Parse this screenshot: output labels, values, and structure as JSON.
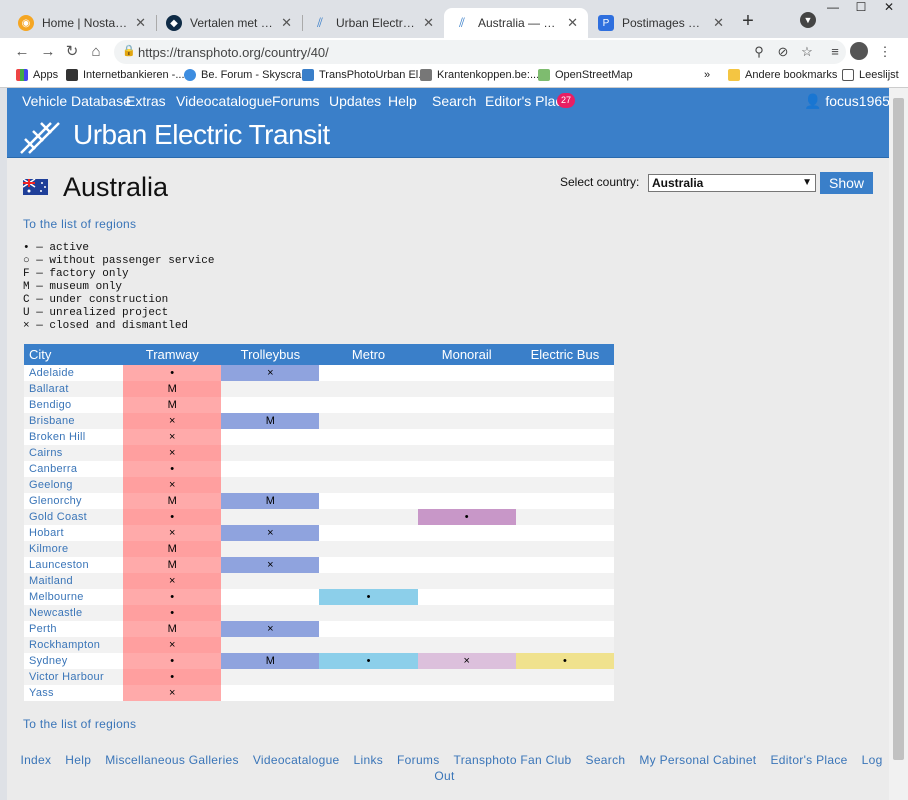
{
  "browser": {
    "tabs": [
      {
        "title": "Home | Nostalgie",
        "active": false,
        "icon_color": "#f5a623"
      },
      {
        "title": "Vertalen met DeepL Tra",
        "active": false,
        "icon_color": "#0f2b46"
      },
      {
        "title": "Urban Electric Transit —",
        "active": false,
        "icon_color": "#3a7fc9"
      },
      {
        "title": "Australia — Urban Elec",
        "active": true,
        "icon_color": "#3a7fc9"
      },
      {
        "title": "Postimages — Gratis af",
        "active": false,
        "icon_color": "#2f6fde"
      }
    ],
    "url": "https://transphoto.org/country/40/",
    "bookmarks": [
      {
        "label": "Apps"
      },
      {
        "label": "Internetbankieren -..."
      },
      {
        "label": "Be. Forum - Skyscra..."
      },
      {
        "label": "TransPhotoUrban El..."
      },
      {
        "label": "Krantenkoppen.be:..."
      },
      {
        "label": "OpenStreetMap"
      },
      {
        "label": "Andere bookmarks"
      },
      {
        "label": "Leeslijst"
      }
    ],
    "more_bookmarks": "»"
  },
  "site": {
    "nav": [
      "Vehicle Database",
      "Extras",
      "Videocatalogue",
      "Forums",
      "Updates",
      "Help",
      "Search",
      "Editor's Place"
    ],
    "editor_badge": "27",
    "user": "focus1965",
    "title": "Urban Electric Transit"
  },
  "country": {
    "name": "Australia",
    "select_label": "Select country:",
    "selected": "Australia",
    "show_button": "Show",
    "regions_link": "To the list of regions"
  },
  "legend": [
    "• — active",
    "○ — without passenger service",
    "F — factory only",
    "M — museum only",
    "C — under construction",
    "U — unrealized project",
    "× — closed and dismantled"
  ],
  "table": {
    "headers": [
      "City",
      "Tramway",
      "Trolleybus",
      "Metro",
      "Monorail",
      "Electric Bus"
    ],
    "rows": [
      {
        "city": "Adelaide",
        "tram": "•",
        "trol": "×",
        "metro": "",
        "mono": "",
        "ebus": ""
      },
      {
        "city": "Ballarat",
        "tram": "M",
        "trol": "",
        "metro": "",
        "mono": "",
        "ebus": ""
      },
      {
        "city": "Bendigo",
        "tram": "M",
        "trol": "",
        "metro": "",
        "mono": "",
        "ebus": ""
      },
      {
        "city": "Brisbane",
        "tram": "×",
        "trol": "M",
        "metro": "",
        "mono": "",
        "ebus": ""
      },
      {
        "city": "Broken Hill",
        "tram": "×",
        "trol": "",
        "metro": "",
        "mono": "",
        "ebus": ""
      },
      {
        "city": "Cairns",
        "tram": "×",
        "trol": "",
        "metro": "",
        "mono": "",
        "ebus": ""
      },
      {
        "city": "Canberra",
        "tram": "•",
        "trol": "",
        "metro": "",
        "mono": "",
        "ebus": ""
      },
      {
        "city": "Geelong",
        "tram": "×",
        "trol": "",
        "metro": "",
        "mono": "",
        "ebus": ""
      },
      {
        "city": "Glenorchy",
        "tram": "M",
        "trol": "M",
        "metro": "",
        "mono": "",
        "ebus": ""
      },
      {
        "city": "Gold Coast",
        "tram": "•",
        "trol": "",
        "metro": "",
        "mono": "•",
        "ebus": ""
      },
      {
        "city": "Hobart",
        "tram": "×",
        "trol": "×",
        "metro": "",
        "mono": "",
        "ebus": ""
      },
      {
        "city": "Kilmore",
        "tram": "M",
        "trol": "",
        "metro": "",
        "mono": "",
        "ebus": ""
      },
      {
        "city": "Launceston",
        "tram": "M",
        "trol": "×",
        "metro": "",
        "mono": "",
        "ebus": ""
      },
      {
        "city": "Maitland",
        "tram": "×",
        "trol": "",
        "metro": "",
        "mono": "",
        "ebus": ""
      },
      {
        "city": "Melbourne",
        "tram": "•",
        "trol": "",
        "metro": "•",
        "mono": "",
        "ebus": ""
      },
      {
        "city": "Newcastle",
        "tram": "•",
        "trol": "",
        "metro": "",
        "mono": "",
        "ebus": ""
      },
      {
        "city": "Perth",
        "tram": "M",
        "trol": "×",
        "metro": "",
        "mono": "",
        "ebus": ""
      },
      {
        "city": "Rockhampton",
        "tram": "×",
        "trol": "",
        "metro": "",
        "mono": "",
        "ebus": ""
      },
      {
        "city": "Sydney",
        "tram": "•",
        "trol": "M",
        "metro": "•",
        "mono": "×",
        "ebus": "•"
      },
      {
        "city": "Victor Harbour",
        "tram": "•",
        "trol": "",
        "metro": "",
        "mono": "",
        "ebus": ""
      },
      {
        "city": "Yass",
        "tram": "×",
        "trol": "",
        "metro": "",
        "mono": "",
        "ebus": ""
      }
    ]
  },
  "footer": [
    "Index",
    "Help",
    "Miscellaneous Galleries",
    "Videocatalogue",
    "Links",
    "Forums",
    "Transphoto Fan Club",
    "Search",
    "My Personal Cabinet",
    "Editor's Place",
    "Log Out"
  ],
  "colors": {
    "brand_blue": "#3a7fc9",
    "tramway": "#ffaaaa",
    "trolleybus": "#8fa3de",
    "metro": "#8ccfea",
    "monorail": "#c897c8",
    "electric_bus": "#f0e28e"
  }
}
